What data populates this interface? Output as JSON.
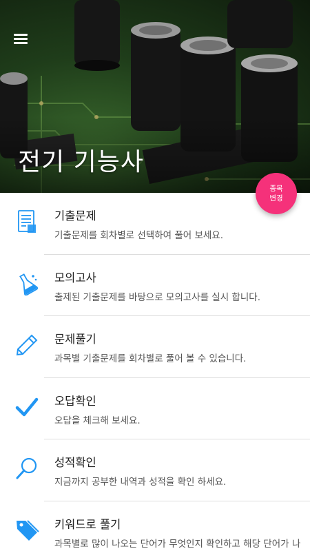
{
  "header": {
    "app_title": "전기 기능사",
    "menu_icon": "hamburger-menu-icon",
    "background_image": "circuit-board-capacitors-photo"
  },
  "fab": {
    "line1": "종목",
    "line2": "변경",
    "color": "#f5317a"
  },
  "accent_color": "#2196f3",
  "menu": {
    "items": [
      {
        "icon": "document-list-icon",
        "title": "기출문제",
        "description": "기출문제를 회차별로 선택하여 풀어 보세요."
      },
      {
        "icon": "flask-icon",
        "title": "모의고사",
        "description": "출제된 기출문제를 바탕으로 모의고사를 실시 합니다."
      },
      {
        "icon": "pencil-icon",
        "title": "문제풀기",
        "description": "과목별 기출문제를 회차별로 풀어 볼 수 있습니다."
      },
      {
        "icon": "checkmark-icon",
        "title": "오답확인",
        "description": "오답을 체크해 보세요."
      },
      {
        "icon": "magnifier-icon",
        "title": "성적확인",
        "description": "지금까지 공부한 내역과 성적을 확인 하세요."
      },
      {
        "icon": "tag-icon",
        "title": "키워드로 풀기",
        "description": "과목별로 많이 나오는 단어가 무엇인지 확인하고 해당 단어가 나오는 문제들을 풀어보세요."
      }
    ]
  }
}
